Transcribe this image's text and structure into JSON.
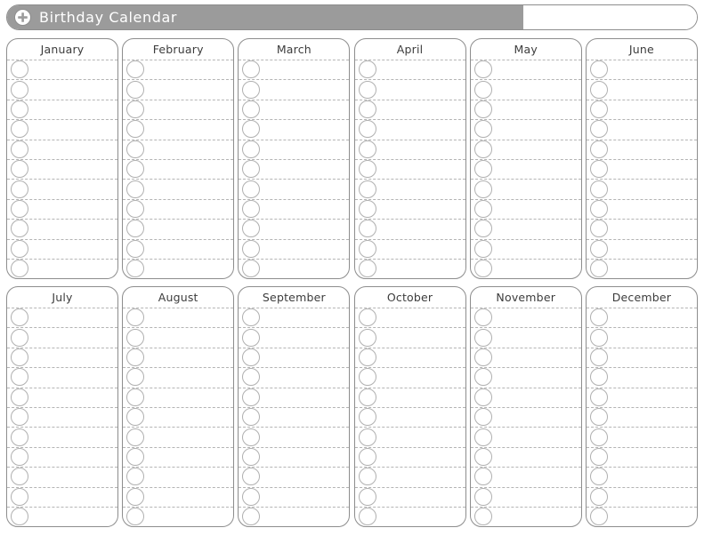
{
  "header": {
    "title": "Birthday Calendar",
    "add_icon": "plus-circle-icon",
    "input_value": "",
    "input_placeholder": "",
    "bar_color": "#9b9b9b",
    "border_color": "#8d8d8d",
    "title_color": "#ffffff"
  },
  "calendar": {
    "rows_of_lines_per_month": 11,
    "line_color": "#b4b4b4",
    "circle_color": "#b0b0b0",
    "box_border_color": "#8d8d8d",
    "month_name_color": "#3c3c3c",
    "rows": [
      {
        "months": [
          {
            "name": "January",
            "entries": [
              "",
              "",
              "",
              "",
              "",
              "",
              "",
              "",
              "",
              "",
              ""
            ]
          },
          {
            "name": "February",
            "entries": [
              "",
              "",
              "",
              "",
              "",
              "",
              "",
              "",
              "",
              "",
              ""
            ]
          },
          {
            "name": "March",
            "entries": [
              "",
              "",
              "",
              "",
              "",
              "",
              "",
              "",
              "",
              "",
              ""
            ]
          },
          {
            "name": "April",
            "entries": [
              "",
              "",
              "",
              "",
              "",
              "",
              "",
              "",
              "",
              "",
              ""
            ]
          },
          {
            "name": "May",
            "entries": [
              "",
              "",
              "",
              "",
              "",
              "",
              "",
              "",
              "",
              "",
              ""
            ]
          },
          {
            "name": "June",
            "entries": [
              "",
              "",
              "",
              "",
              "",
              "",
              "",
              "",
              "",
              "",
              ""
            ]
          }
        ]
      },
      {
        "months": [
          {
            "name": "July",
            "entries": [
              "",
              "",
              "",
              "",
              "",
              "",
              "",
              "",
              "",
              "",
              ""
            ]
          },
          {
            "name": "August",
            "entries": [
              "",
              "",
              "",
              "",
              "",
              "",
              "",
              "",
              "",
              "",
              ""
            ]
          },
          {
            "name": "September",
            "entries": [
              "",
              "",
              "",
              "",
              "",
              "",
              "",
              "",
              "",
              "",
              ""
            ]
          },
          {
            "name": "October",
            "entries": [
              "",
              "",
              "",
              "",
              "",
              "",
              "",
              "",
              "",
              "",
              ""
            ]
          },
          {
            "name": "November",
            "entries": [
              "",
              "",
              "",
              "",
              "",
              "",
              "",
              "",
              "",
              "",
              ""
            ]
          },
          {
            "name": "December",
            "entries": [
              "",
              "",
              "",
              "",
              "",
              "",
              "",
              "",
              "",
              "",
              ""
            ]
          }
        ]
      }
    ]
  }
}
